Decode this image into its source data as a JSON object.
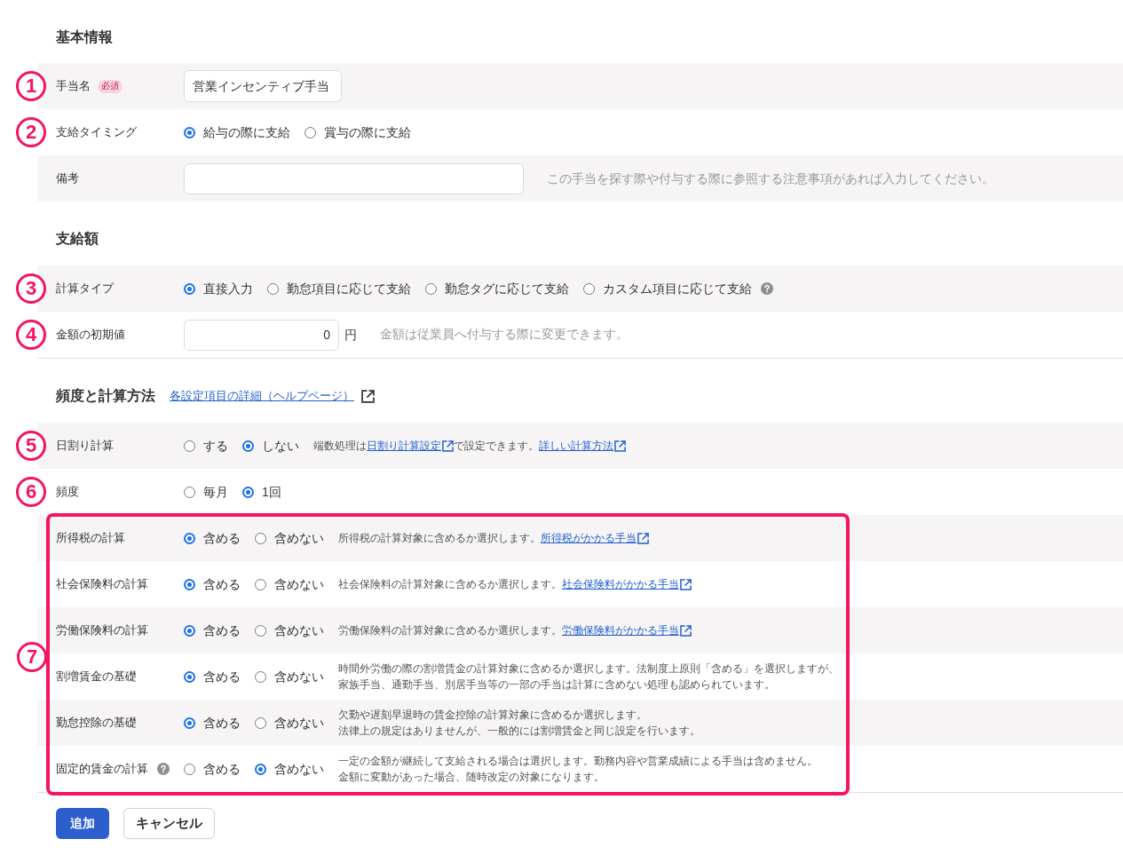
{
  "sections": [
    {
      "title": "基本情報",
      "rows": [
        {
          "kind": "text",
          "annotation": "1",
          "label": "手当名",
          "badge": "必須",
          "value": "営業インセンティブ手当"
        },
        {
          "kind": "radio",
          "annotation": "2",
          "label": "支給タイミング",
          "options": [
            {
              "label": "給与の際に支給",
              "selected": true
            },
            {
              "label": "賞与の際に支給",
              "selected": false
            }
          ]
        },
        {
          "kind": "note",
          "label": "備考",
          "hint": "この手当を探す際や付与する際に参照する注意事項があれば入力してください。"
        }
      ]
    },
    {
      "title": "支給額",
      "rows": [
        {
          "kind": "radio",
          "annotation": "3",
          "label": "計算タイプ",
          "options_help": true,
          "options": [
            {
              "label": "直接入力",
              "selected": true
            },
            {
              "label": "勤怠項目に応じて支給",
              "selected": false
            },
            {
              "label": "勤怠タグに応じて支給",
              "selected": false
            },
            {
              "label": "カスタム項目に応じて支給",
              "selected": false
            }
          ]
        },
        {
          "kind": "amount",
          "annotation": "4",
          "label": "金額の初期値",
          "value": "0",
          "unit": "円",
          "hint": "金額は従業員へ付与する際に変更できます。"
        }
      ]
    },
    {
      "title": "頻度と計算方法",
      "link": "各設定項目の詳細（ヘルプページ）",
      "rows": [
        {
          "kind": "radio",
          "annotation": "5",
          "label": "日割り計算",
          "options": [
            {
              "label": "する",
              "selected": false
            },
            {
              "label": "しない",
              "selected": true
            }
          ],
          "description": [
            [
              {
                "kind": "text",
                "text": "端数処理は"
              },
              {
                "kind": "link",
                "text": "日割り計算設定"
              },
              {
                "kind": "text",
                "text": "で設定できます。"
              },
              {
                "kind": "link",
                "text": "詳しい計算方法"
              }
            ]
          ]
        },
        {
          "kind": "radio",
          "annotation": "6",
          "label": "頻度",
          "options": [
            {
              "label": "毎月",
              "selected": false
            },
            {
              "label": "1回",
              "selected": true
            }
          ]
        }
      ],
      "highlighted_group": {
        "annotation": "7",
        "rows": [
          {
            "kind": "radio",
            "label": "所得税の計算",
            "options": [
              {
                "label": "含める",
                "selected": true
              },
              {
                "label": "含めない",
                "selected": false
              }
            ],
            "description": [
              [
                {
                  "kind": "text",
                  "text": "所得税の計算対象に含めるか選択します。"
                },
                {
                  "kind": "link",
                  "text": "所得税がかかる手当"
                }
              ]
            ]
          },
          {
            "kind": "radio",
            "label": "社会保険料の計算",
            "options": [
              {
                "label": "含める",
                "selected": true
              },
              {
                "label": "含めない",
                "selected": false
              }
            ],
            "description": [
              [
                {
                  "kind": "text",
                  "text": "社会保険料の計算対象に含めるか選択します。"
                },
                {
                  "kind": "link",
                  "text": "社会保険料がかかる手当"
                }
              ]
            ]
          },
          {
            "kind": "radio",
            "label": "労働保険料の計算",
            "options": [
              {
                "label": "含める",
                "selected": true
              },
              {
                "label": "含めない",
                "selected": false
              }
            ],
            "description": [
              [
                {
                  "kind": "text",
                  "text": "労働保険料の計算対象に含めるか選択します。"
                },
                {
                  "kind": "link",
                  "text": "労働保険料がかかる手当"
                }
              ]
            ]
          },
          {
            "kind": "radio",
            "label": "割増賃金の基礎",
            "options": [
              {
                "label": "含める",
                "selected": true
              },
              {
                "label": "含めない",
                "selected": false
              }
            ],
            "description": [
              [
                {
                  "kind": "text",
                  "text": "時間外労働の際の割増賃金の計算対象に含めるか選択します。法制度上原則「含める」を選択しますが、"
                }
              ],
              [
                {
                  "kind": "text",
                  "text": "家族手当、通勤手当、別居手当等の一部の手当は計算に含めない処理も認められています。"
                }
              ]
            ]
          },
          {
            "kind": "radio",
            "label": "勤怠控除の基礎",
            "options": [
              {
                "label": "含める",
                "selected": true
              },
              {
                "label": "含めない",
                "selected": false
              }
            ],
            "description": [
              [
                {
                  "kind": "text",
                  "text": "欠勤や遅刻早退時の賃金控除の計算対象に含めるか選択します。"
                }
              ],
              [
                {
                  "kind": "text",
                  "text": "法律上の規定はありませんが、一般的には割増賃金と同じ設定を行います。"
                }
              ]
            ]
          },
          {
            "kind": "radio",
            "label": "固定的賃金の計算",
            "label_help": true,
            "options": [
              {
                "label": "含める",
                "selected": false
              },
              {
                "label": "含めない",
                "selected": true
              }
            ],
            "description": [
              [
                {
                  "kind": "text",
                  "text": "一定の金額が継続して支給される場合は選択します。勤務内容や営業成績による手当は含めません。"
                }
              ],
              [
                {
                  "kind": "text",
                  "text": "金額に変動があった場合、随時改定の対象になります。"
                }
              ]
            ]
          }
        ]
      }
    }
  ],
  "buttons": [
    {
      "kind": "primary",
      "label": "追加"
    },
    {
      "kind": "secondary",
      "label": "キャンセル"
    }
  ]
}
